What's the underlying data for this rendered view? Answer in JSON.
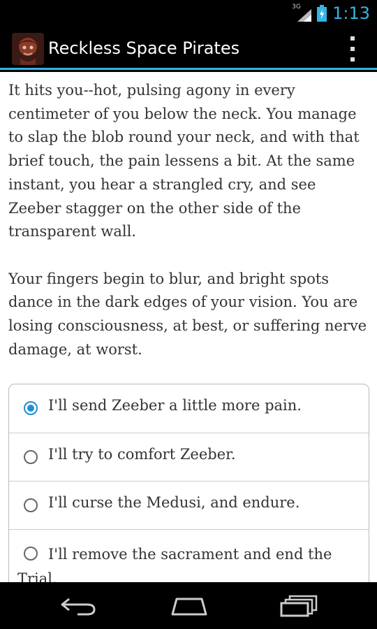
{
  "status_bar": {
    "network_label": "3G",
    "time": "1:13",
    "accent_color": "#33b5e5"
  },
  "action_bar": {
    "app_title": "Reckless Space Pirates",
    "app_icon": "pirate-app-icon",
    "overflow_icon": "overflow-menu-icon"
  },
  "story": {
    "paragraphs": [
      "It hits you--hot, pulsing agony in every centimeter of you below the neck. You manage to slap the blob round your neck, and with that brief touch, the pain lessens a bit. At the same instant, you hear a strangled cry, and see Zeeber stagger on the other side of the transparent wall.",
      "Your fingers begin to blur, and bright spots dance in the dark edges of your vision. You are losing consciousness, at best, or suffering nerve damage, at worst."
    ]
  },
  "choices": [
    {
      "label": "I'll send Zeeber a little more pain.",
      "selected": true
    },
    {
      "label": "I'll try to comfort Zeeber.",
      "selected": false
    },
    {
      "label": "I'll curse the Medusi, and endure.",
      "selected": false
    },
    {
      "label": "I'll remove the sacrament and end the Trial.",
      "selected": false
    }
  ],
  "nav_bar": {
    "back_icon": "back-icon",
    "home_icon": "home-icon",
    "recents_icon": "recents-icon"
  }
}
